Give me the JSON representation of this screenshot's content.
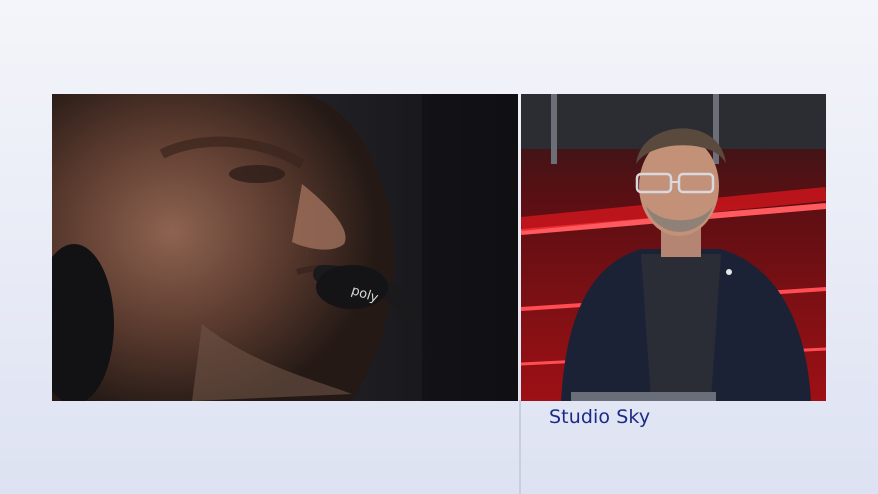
{
  "panels": {
    "left": {
      "icon": "video-feed-driver-closeup-icon"
    },
    "right": {
      "icon": "video-feed-studio-presenter-icon"
    }
  },
  "caption": {
    "text": "Studio Sky"
  },
  "headset": {
    "logo_text": "poly"
  },
  "colors": {
    "background": "#eef0f8",
    "caption": "#1b2a86",
    "studio_red": "#d8141d"
  }
}
